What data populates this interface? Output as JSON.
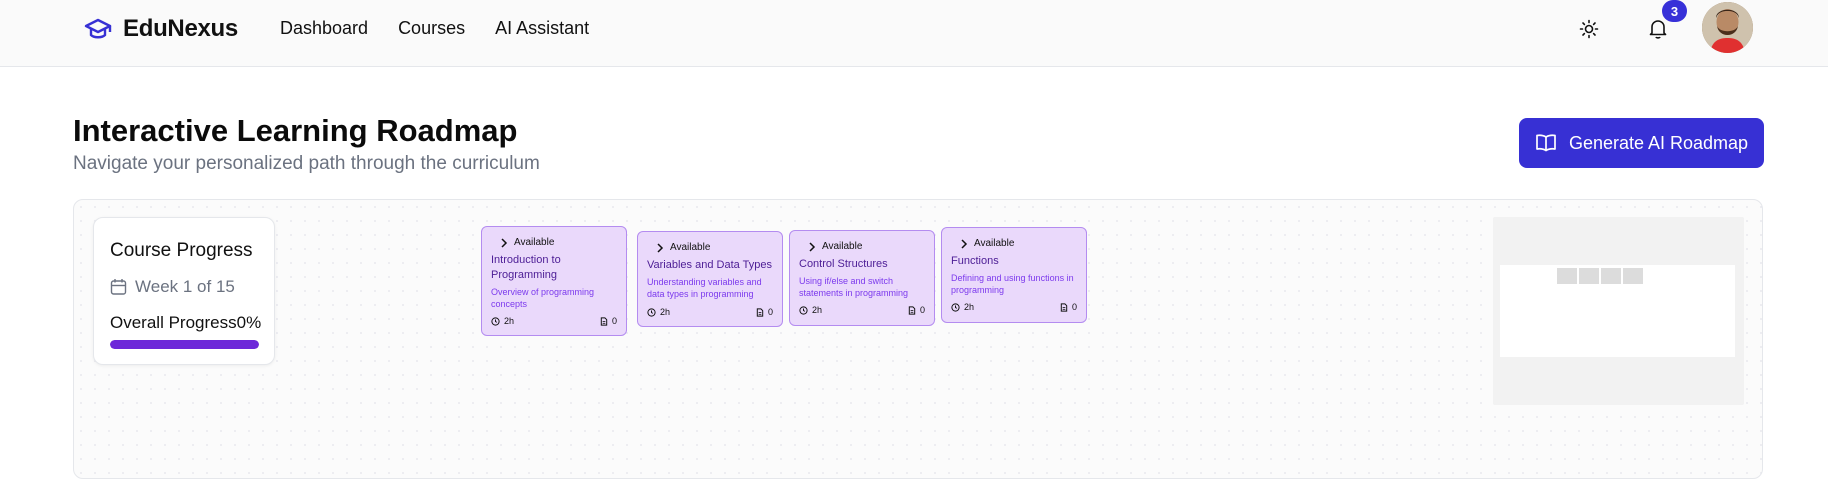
{
  "brand": {
    "name": "EduNexus"
  },
  "nav": {
    "items": [
      "Dashboard",
      "Courses",
      "AI Assistant"
    ]
  },
  "header": {
    "notification_count": "3"
  },
  "page": {
    "title": "Interactive Learning Roadmap",
    "subtitle": "Navigate your personalized path through the curriculum",
    "generate_button": "Generate AI Roadmap"
  },
  "progress": {
    "title": "Course Progress",
    "week": "Week 1 of 15",
    "overall_label": "Overall Progress",
    "overall_value": "0%",
    "bar_fraction": 1.0
  },
  "nodes": [
    {
      "status": "Available",
      "title": "Introduction to Programming",
      "description": "Overview of programming concepts",
      "duration": "2h",
      "resources": "0"
    },
    {
      "status": "Available",
      "title": "Variables and Data Types",
      "description": "Understanding variables and data types in programming",
      "duration": "2h",
      "resources": "0"
    },
    {
      "status": "Available",
      "title": "Control Structures",
      "description": "Using if/else and switch statements in programming",
      "duration": "2h",
      "resources": "0"
    },
    {
      "status": "Available",
      "title": "Functions",
      "description": "Defining and using functions in programming",
      "duration": "2h",
      "resources": "0"
    }
  ],
  "colors": {
    "accent": "#3730d4",
    "node_bg": "#ead9fb",
    "node_border": "#b48cf0",
    "progress_fill": "#6d28d9"
  },
  "icons": {
    "logo": "graduation-cap-icon",
    "theme": "sun-icon",
    "notifications": "bell-icon",
    "generate": "book-open-icon"
  }
}
